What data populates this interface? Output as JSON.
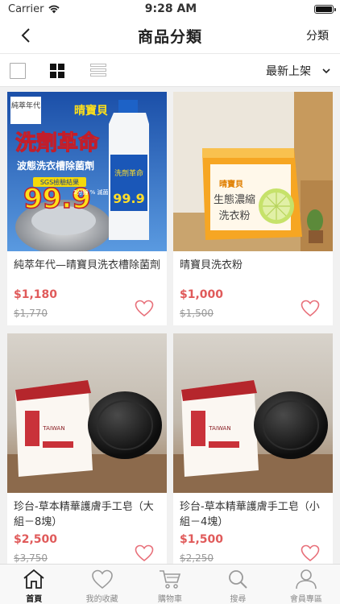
{
  "status_bar": {
    "carrier": "Carrier",
    "time": "9:28 AM",
    "wifi_icon": "wifi-icon",
    "battery_icon": "battery-icon"
  },
  "nav": {
    "back_icon": "chevron-left-icon",
    "title": "商品分類",
    "right_label": "分類"
  },
  "toolbar": {
    "view_modes": [
      "single-view-icon",
      "grid-view-icon",
      "list-view-icon"
    ],
    "active_view": "grid-view-icon",
    "sort_label": "最新上架",
    "sort_icon": "chevron-down-icon"
  },
  "products": [
    {
      "name": "純萃年代—晴寶貝洗衣槽除菌劑",
      "price": "$1,180",
      "original_price": "$1,770",
      "image": {
        "brand_tag": "純萃年代",
        "brand": "晴寶貝",
        "headline": "洗劑革命",
        "subline": "波態洗衣槽除菌劑",
        "sgs": "SGS檢驗結果",
        "number": "99.9",
        "sub": "3分鐘 % 滅菌"
      }
    },
    {
      "name": "晴寶貝洗衣粉",
      "price": "$1,000",
      "original_price": "$1,500",
      "image": {
        "brand": "晴寶貝",
        "line1": "生態濃縮",
        "line2": "洗衣粉"
      }
    },
    {
      "name": "珍台-草本精華護膚手工皂（大組－8塊）",
      "price": "$2,500",
      "original_price": "$3,750",
      "image": {
        "logo": "TAIWAN"
      }
    },
    {
      "name": "珍台-草本精華護膚手工皂（小組－4塊）",
      "price": "$1,500",
      "original_price": "$2,250",
      "image": {
        "logo": "TAIWAN"
      }
    }
  ],
  "tabbar": {
    "items": [
      {
        "label": "首頁",
        "icon": "home-icon",
        "active": true
      },
      {
        "label": "我的收藏",
        "icon": "heart-icon",
        "active": false
      },
      {
        "label": "購物車",
        "icon": "cart-icon",
        "active": false
      },
      {
        "label": "搜尋",
        "icon": "search-icon",
        "active": false
      },
      {
        "label": "會員專區",
        "icon": "user-icon",
        "active": false
      }
    ]
  },
  "colors": {
    "price": "#e05a5a",
    "heart": "#e8707a",
    "page_bg": "#f1f1f1"
  }
}
